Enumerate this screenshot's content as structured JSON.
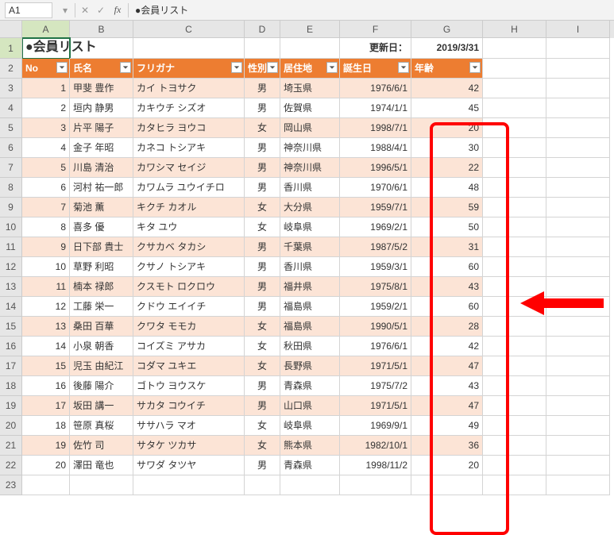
{
  "formula_bar": {
    "name_box": "A1",
    "cancel": "✕",
    "confirm": "✓",
    "fx": "fx",
    "content": "●会員リスト"
  },
  "columns": [
    "A",
    "B",
    "C",
    "D",
    "E",
    "F",
    "G",
    "H",
    "I"
  ],
  "row_numbers": [
    "1",
    "2",
    "3",
    "4",
    "5",
    "6",
    "7",
    "8",
    "9",
    "10",
    "11",
    "12",
    "13",
    "14",
    "15",
    "16",
    "17",
    "18",
    "19",
    "20",
    "21",
    "22",
    "23"
  ],
  "title": "●会員リスト",
  "update_label": "更新日：",
  "update_date": "2019/3/31",
  "headers": {
    "no": "No",
    "name": "氏名",
    "kana": "フリガナ",
    "gender": "性別",
    "pref": "居住地",
    "birth": "誕生日",
    "age": "年齢"
  },
  "rows": [
    {
      "no": "1",
      "name": "甲斐 豊作",
      "kana": "カイ トヨサク",
      "gender": "男",
      "pref": "埼玉県",
      "birth": "1976/6/1",
      "age": "42"
    },
    {
      "no": "2",
      "name": "垣内 静男",
      "kana": "カキウチ シズオ",
      "gender": "男",
      "pref": "佐賀県",
      "birth": "1974/1/1",
      "age": "45"
    },
    {
      "no": "3",
      "name": "片平 陽子",
      "kana": "カタヒラ ヨウコ",
      "gender": "女",
      "pref": "岡山県",
      "birth": "1998/7/1",
      "age": "20"
    },
    {
      "no": "4",
      "name": "金子 年昭",
      "kana": "カネコ トシアキ",
      "gender": "男",
      "pref": "神奈川県",
      "birth": "1988/4/1",
      "age": "30"
    },
    {
      "no": "5",
      "name": "川島 清治",
      "kana": "カワシマ セイジ",
      "gender": "男",
      "pref": "神奈川県",
      "birth": "1996/5/1",
      "age": "22"
    },
    {
      "no": "6",
      "name": "河村 祐一郎",
      "kana": "カワムラ ユウイチロ",
      "gender": "男",
      "pref": "香川県",
      "birth": "1970/6/1",
      "age": "48"
    },
    {
      "no": "7",
      "name": "菊池 薫",
      "kana": "キクチ カオル",
      "gender": "女",
      "pref": "大分県",
      "birth": "1959/7/1",
      "age": "59"
    },
    {
      "no": "8",
      "name": "喜多 優",
      "kana": "キタ ユウ",
      "gender": "女",
      "pref": "岐阜県",
      "birth": "1969/2/1",
      "age": "50"
    },
    {
      "no": "9",
      "name": "日下部 貴士",
      "kana": "クサカベ タカシ",
      "gender": "男",
      "pref": "千葉県",
      "birth": "1987/5/2",
      "age": "31"
    },
    {
      "no": "10",
      "name": "草野 利昭",
      "kana": "クサノ トシアキ",
      "gender": "男",
      "pref": "香川県",
      "birth": "1959/3/1",
      "age": "60"
    },
    {
      "no": "11",
      "name": "楠本 禄郎",
      "kana": "クスモト ロクロウ",
      "gender": "男",
      "pref": "福井県",
      "birth": "1975/8/1",
      "age": "43"
    },
    {
      "no": "12",
      "name": "工藤 栄一",
      "kana": "クドウ エイイチ",
      "gender": "男",
      "pref": "福島県",
      "birth": "1959/2/1",
      "age": "60"
    },
    {
      "no": "13",
      "name": "桑田 百華",
      "kana": "クワタ モモカ",
      "gender": "女",
      "pref": "福島県",
      "birth": "1990/5/1",
      "age": "28"
    },
    {
      "no": "14",
      "name": "小泉 朝香",
      "kana": "コイズミ アサカ",
      "gender": "女",
      "pref": "秋田県",
      "birth": "1976/6/1",
      "age": "42"
    },
    {
      "no": "15",
      "name": "児玉 由紀江",
      "kana": "コダマ ユキエ",
      "gender": "女",
      "pref": "長野県",
      "birth": "1971/5/1",
      "age": "47"
    },
    {
      "no": "16",
      "name": "後藤 陽介",
      "kana": "ゴトウ ヨウスケ",
      "gender": "男",
      "pref": "青森県",
      "birth": "1975/7/2",
      "age": "43"
    },
    {
      "no": "17",
      "name": "坂田 講一",
      "kana": "サカタ コウイチ",
      "gender": "男",
      "pref": "山口県",
      "birth": "1971/5/1",
      "age": "47"
    },
    {
      "no": "18",
      "name": "笹原 真桜",
      "kana": "ササハラ マオ",
      "gender": "女",
      "pref": "岐阜県",
      "birth": "1969/9/1",
      "age": "49"
    },
    {
      "no": "19",
      "name": "佐竹 司",
      "kana": "サタケ ツカサ",
      "gender": "女",
      "pref": "熊本県",
      "birth": "1982/10/1",
      "age": "36"
    },
    {
      "no": "20",
      "name": "澤田 竜也",
      "kana": "サワダ タツヤ",
      "gender": "男",
      "pref": "青森県",
      "birth": "1998/11/2",
      "age": "20"
    }
  ]
}
